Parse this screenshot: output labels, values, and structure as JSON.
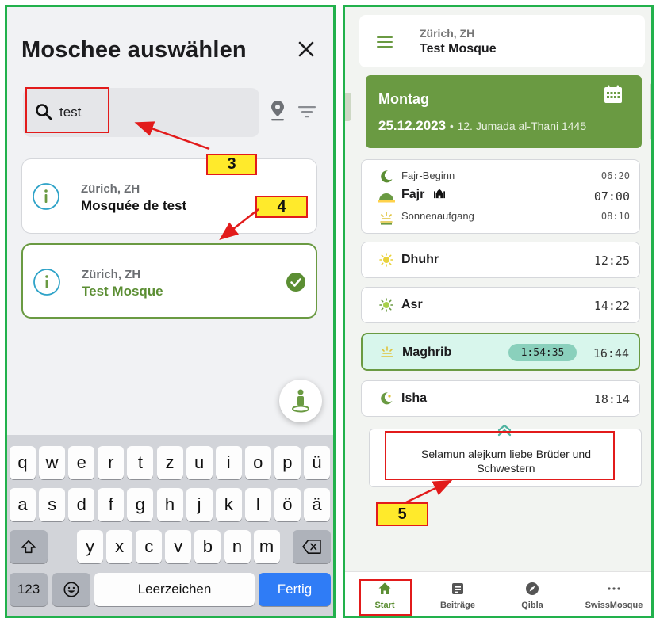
{
  "left_panel": {
    "title": "Moschee auswählen",
    "search": {
      "value": "test",
      "placeholder": ""
    },
    "results": [
      {
        "city": "Zürich, ZH",
        "name": "Mosquée de test",
        "selected": false
      },
      {
        "city": "Zürich, ZH",
        "name": "Test Mosque",
        "selected": true
      }
    ],
    "keyboard": {
      "row1": [
        "q",
        "w",
        "e",
        "r",
        "t",
        "z",
        "u",
        "i",
        "o",
        "p",
        "ü"
      ],
      "row2": [
        "a",
        "s",
        "d",
        "f",
        "g",
        "h",
        "j",
        "k",
        "l",
        "ö",
        "ä"
      ],
      "row3": [
        "y",
        "x",
        "c",
        "v",
        "b",
        "n",
        "m"
      ],
      "numbers_label": "123",
      "space_label": "Leerzeichen",
      "done_label": "Fertig"
    }
  },
  "right_panel": {
    "header": {
      "city": "Zürich, ZH",
      "mosque": "Test Mosque"
    },
    "date": {
      "day": "Montag",
      "gregorian": "25.12.2023",
      "separator": "•",
      "hijri": "12. Jumada al-Thani 1445"
    },
    "prayers": {
      "fajr_start": {
        "label": "Fajr-Beginn",
        "time": "06:20"
      },
      "fajr": {
        "label": "Fajr",
        "time": "07:00"
      },
      "sunrise": {
        "label": "Sonnenaufgang",
        "time": "08:10"
      },
      "dhuhr": {
        "label": "Dhuhr",
        "time": "12:25"
      },
      "asr": {
        "label": "Asr",
        "time": "14:22"
      },
      "maghrib": {
        "label": "Maghrib",
        "time": "16:44",
        "countdown": "1:54:35"
      },
      "isha": {
        "label": "Isha",
        "time": "18:14"
      }
    },
    "message": "Selamun alejkum liebe Brüder und Schwestern",
    "nav": [
      {
        "label": "Start",
        "active": true
      },
      {
        "label": "Beiträge",
        "active": false
      },
      {
        "label": "Qibla",
        "active": false
      },
      {
        "label": "SwissMosque",
        "active": false
      }
    ]
  },
  "annotations": {
    "step3": "3",
    "step4": "4",
    "step5": "5"
  },
  "colors": {
    "accent_green": "#6a9a42",
    "frame_green": "#22b14c",
    "annotation_red": "#e21b1b",
    "annotation_yellow": "#ffea2b",
    "active_prayer_bg": "#d8f6ec",
    "keyboard_blue": "#2f7cf6"
  },
  "icons": [
    "close-icon",
    "search-icon",
    "location-pin-icon",
    "filter-icon",
    "info-icon",
    "check-icon",
    "geolocate-icon",
    "shift-icon",
    "backspace-icon",
    "emoji-icon",
    "menu-icon",
    "calendar-icon",
    "moon-icon",
    "sunrise-icon",
    "mosque-icon",
    "sun-icon",
    "chevron-up-icon",
    "home-icon",
    "news-icon",
    "compass-icon",
    "more-icon"
  ]
}
